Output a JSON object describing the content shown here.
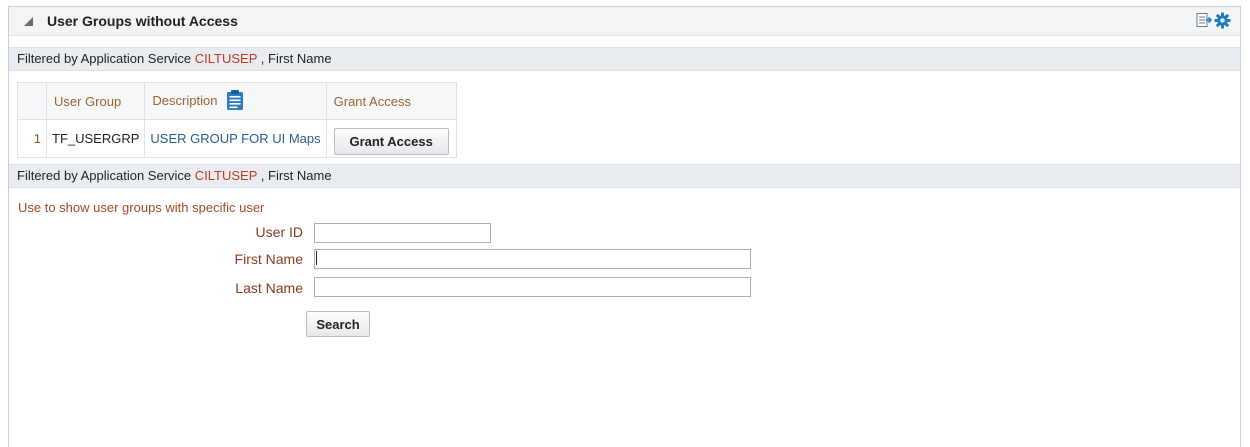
{
  "panel": {
    "title": "User Groups without Access"
  },
  "filter1": {
    "prefix": "Filtered by Application Service",
    "service": "CILTUSEP",
    "suffix": ", First Name"
  },
  "table": {
    "columns": [
      "User Group",
      "Description",
      "Grant Access"
    ],
    "rows": [
      {
        "num": "1",
        "user_group": "TF_USERGRP",
        "description": "USER GROUP FOR UI Maps",
        "button_label": "Grant Access"
      }
    ]
  },
  "filter2": {
    "prefix": "Filtered by Application Service",
    "service": "CILTUSEP",
    "suffix": ", First Name"
  },
  "form": {
    "hint": "Use to show user groups with specific user",
    "user_id_label": "User ID",
    "user_id_value": "",
    "first_name_label": "First Name",
    "first_name_value": "",
    "last_name_label": "Last Name",
    "last_name_value": "",
    "search_label": "Search"
  },
  "icons": {
    "header_left": "collapse-triangle-icon",
    "header_right_1": "detach-table-icon",
    "header_right_2": "gear-icon",
    "description_column": "clipboard-icon"
  },
  "colors": {
    "service_text": "#c0391b",
    "label_text": "#8a3a1f",
    "link_text": "#2a5d8c",
    "accent_blue": "#1f7bc2"
  }
}
